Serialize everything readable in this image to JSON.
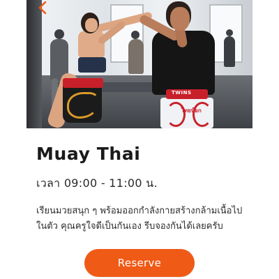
{
  "header": {
    "back_icon": "chevron-left-icon",
    "accent_color": "#ef5a16"
  },
  "hero": {
    "shorts_brand": "TWINS",
    "shorts_text": "ไทยบ๊อก"
  },
  "class": {
    "title": "Muay Thai",
    "time": "เวลา 09:00 - 11:00 น.",
    "description": "เรียนมวยสนุก ๆ พร้อมออกกำลังกายสร้างกล้ามเนื้อไปในตัว คุณครูใจดีเป็นกันเอง รีบจองกันได้เลยครับ"
  },
  "actions": {
    "reserve_label": "Reserve",
    "reserve_color": "#ef5a16"
  }
}
